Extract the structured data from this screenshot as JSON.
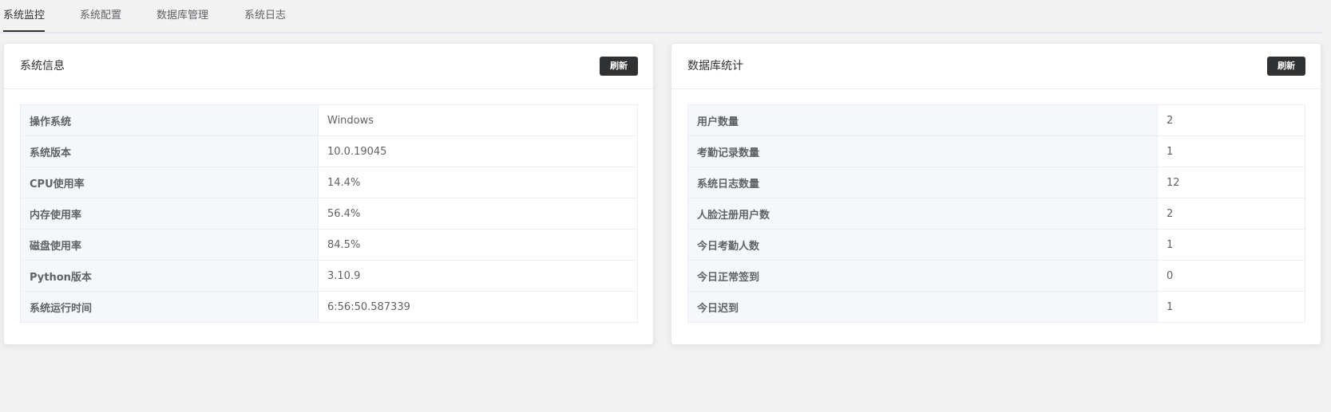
{
  "tabs": [
    {
      "label": "系统监控",
      "active": true
    },
    {
      "label": "系统配置",
      "active": false
    },
    {
      "label": "数据库管理",
      "active": false
    },
    {
      "label": "系统日志",
      "active": false
    }
  ],
  "system_info": {
    "title": "系统信息",
    "refresh_label": "刷新",
    "rows": [
      {
        "label": "操作系统",
        "value": "Windows"
      },
      {
        "label": "系统版本",
        "value": "10.0.19045"
      },
      {
        "label": "CPU使用率",
        "value": "14.4%"
      },
      {
        "label": "内存使用率",
        "value": "56.4%"
      },
      {
        "label": "磁盘使用率",
        "value": "84.5%"
      },
      {
        "label": "Python版本",
        "value": "3.10.9"
      },
      {
        "label": "系统运行时间",
        "value": "6:56:50.587339"
      }
    ]
  },
  "db_stats": {
    "title": "数据库统计",
    "refresh_label": "刷新",
    "rows": [
      {
        "label": "用户数量",
        "value": "2"
      },
      {
        "label": "考勤记录数量",
        "value": "1"
      },
      {
        "label": "系统日志数量",
        "value": "12"
      },
      {
        "label": "人脸注册用户数",
        "value": "2"
      },
      {
        "label": "今日考勤人数",
        "value": "1"
      },
      {
        "label": "今日正常签到",
        "value": "0"
      },
      {
        "label": "今日迟到",
        "value": "1"
      }
    ]
  }
}
